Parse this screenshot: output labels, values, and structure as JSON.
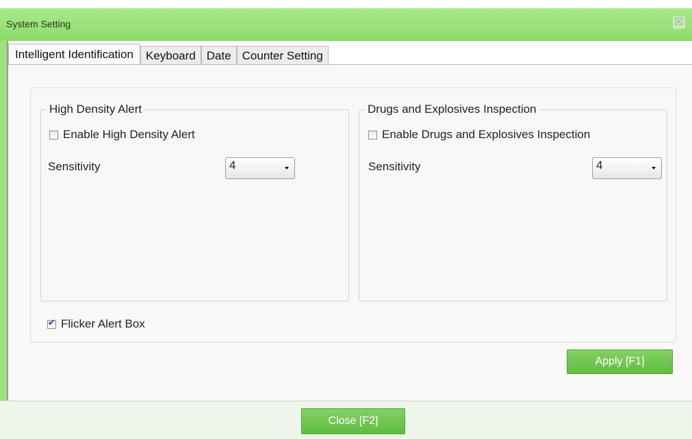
{
  "window": {
    "title": "System Setting",
    "close_glyph": "☒"
  },
  "tabs": [
    {
      "label": "Intelligent Identification",
      "active": true
    },
    {
      "label": "Keyboard",
      "active": false
    },
    {
      "label": "Date",
      "active": false
    },
    {
      "label": "Counter Setting",
      "active": false
    }
  ],
  "high_density": {
    "legend": "High Density Alert",
    "enable_label": "Enable High Density Alert",
    "enabled": false,
    "sensitivity_label": "Sensitivity",
    "sensitivity_value": "4"
  },
  "drugs_explosives": {
    "legend": "Drugs and Explosives Inspection",
    "enable_label": "Enable Drugs and Explosives Inspection",
    "enabled": false,
    "sensitivity_label": "Sensitivity",
    "sensitivity_value": "4"
  },
  "flicker": {
    "label": "Flicker Alert Box",
    "checked": true
  },
  "buttons": {
    "apply": "Apply [F1]",
    "close": "Close [F2]"
  },
  "colors": {
    "title_bar": "#9fe07f",
    "button": "#6cc24a"
  }
}
